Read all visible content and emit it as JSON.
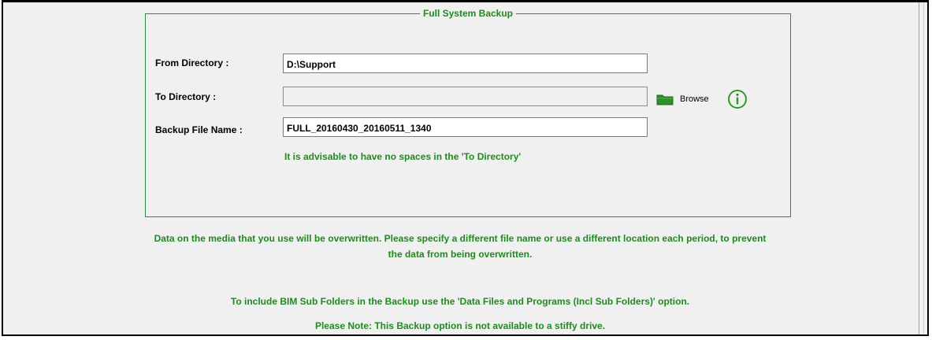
{
  "group": {
    "title": "Full System Backup"
  },
  "form": {
    "from_directory_label": "From Directory :",
    "from_directory_value": "D:\\Support",
    "to_directory_label": "To Directory :",
    "to_directory_value": "",
    "backup_file_name_label": "Backup File Name :",
    "backup_file_name_value": "FULL_20160430_20160511_1340",
    "browse_label": "Browse",
    "advice": "It is advisable to have no spaces in the 'To Directory'"
  },
  "notes": {
    "overwrite_line1": "Data on the media that you use will be overwritten. Please specify a different file name or use a different location each period, to prevent",
    "overwrite_line2": "the data from being overwritten.",
    "subfolders": "To include BIM Sub Folders in the Backup use the 'Data Files and Programs (Incl Sub Folders)' option.",
    "stiffy": "Please Note: This Backup option  is not available to a stiffy drive."
  },
  "icons": {
    "folder": "folder-icon",
    "info": "info-icon"
  },
  "colors": {
    "accent_green": "#1f8a1f",
    "group_border": "#2e8b2e",
    "folder_green": "#2f8f2f",
    "window_bg": "#f0f0f0"
  }
}
